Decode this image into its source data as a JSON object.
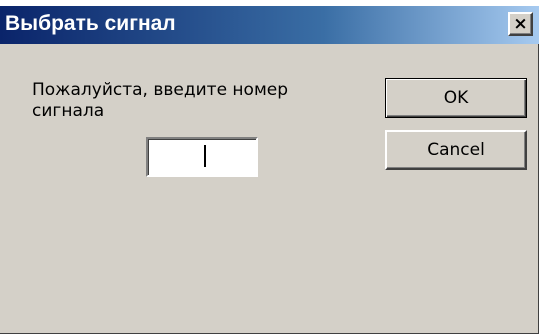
{
  "dialog": {
    "title": "Выбрать сигнал",
    "close_glyph": "×",
    "prompt": "Пожалуйста,  введите номер сигнала",
    "input_value": "",
    "ok_label": "OK",
    "cancel_label": "Cancel"
  },
  "colors": {
    "titlebar_start": "#0a246a",
    "titlebar_end": "#a6caf0",
    "window_bg": "#d4d0c8"
  }
}
